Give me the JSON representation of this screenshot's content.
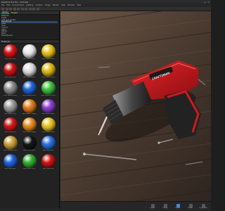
{
  "window": {
    "title": "KeyShot 8.0 Pro - Drill.bip",
    "buttons": [
      "–",
      "□",
      "×"
    ]
  },
  "menubar": {
    "items": [
      "File",
      "Edit",
      "Environment",
      "Lighting",
      "Camera",
      "Image",
      "Render",
      "View",
      "Window",
      "Help"
    ]
  },
  "sidebar": {
    "tabs": [
      "Library",
      "Project"
    ],
    "active_tab": "Library",
    "tree": [
      "Materials",
      "  Axalta",
      "  Cloth and Leather",
      "  Gem Stones",
      "  Glass",
      "    Clear",
      "    Colored",
      "  Light",
      "  Liquids",
      "  Metal",
      "  Miscellaneous"
    ],
    "selected_tree_index": 3,
    "materials_header": "Materials",
    "materials": [
      {
        "label": "Paint Gloss Red",
        "color": "#d41414"
      },
      {
        "label": "Paint Gloss White",
        "color": "#e8e8e8"
      },
      {
        "label": "Paint Gloss Yellow",
        "color": "#e8c21a"
      },
      {
        "label": "Paint Gloss Red",
        "color": "#c91212"
      },
      {
        "label": "Paint Gloss White",
        "color": "#dcdcdc"
      },
      {
        "label": "Paint Gloss Yellow",
        "color": "#e0b816"
      },
      {
        "label": "Paint Metallic Grey",
        "color": "#8a8a8a"
      },
      {
        "label": "Paint Metallic Blue",
        "color": "#1f64d6"
      },
      {
        "label": "Paint Metallic Green",
        "color": "#3cc23c"
      },
      {
        "label": "Paint Matte Grey",
        "color": "#9a9a9a"
      },
      {
        "label": "Paint Matte Orange",
        "color": "#e07a18"
      },
      {
        "label": "Paint Matte Purple",
        "color": "#8a3fd0"
      },
      {
        "label": "Paint Gloss Red",
        "color": "#d01818"
      },
      {
        "label": "Paint Gloss Orange",
        "color": "#e58a1c"
      },
      {
        "label": "Paint Gloss Yellow",
        "color": "#e9c520"
      },
      {
        "label": "Paint Metallic Gold",
        "color": "#c9a03a"
      },
      {
        "label": "Paint Gloss Black",
        "color": "#151515"
      },
      {
        "label": "Paint Gloss Blue",
        "color": "#2a6fe0"
      },
      {
        "label": "Paint Gloss Blue",
        "color": "#2060d8"
      },
      {
        "label": "Paint Gloss Green",
        "color": "#2fae2f"
      },
      {
        "label": "Paint Gloss Red",
        "color": "#cc1414"
      }
    ]
  },
  "bottombar": {
    "buttons": [
      {
        "label": "Import",
        "active": false
      },
      {
        "label": "Library",
        "active": false
      },
      {
        "label": "Project",
        "active": true
      },
      {
        "label": "Render",
        "active": false
      },
      {
        "label": "KeyShotXR",
        "active": false
      }
    ]
  },
  "viewport": {
    "drill_brand": "CRAFTSMAN"
  }
}
